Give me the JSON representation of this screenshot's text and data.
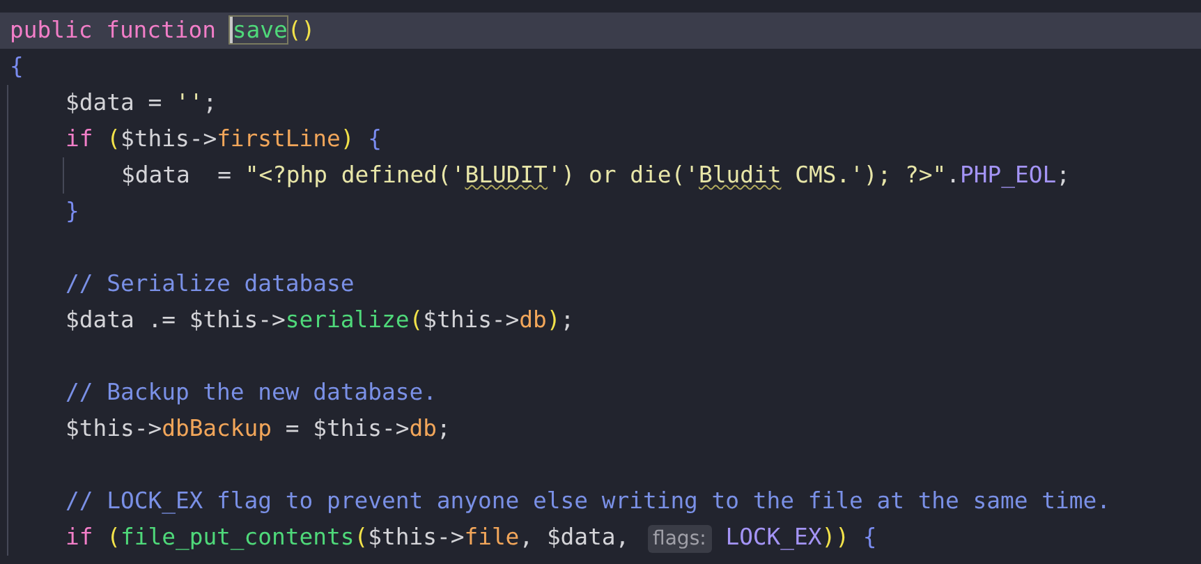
{
  "editor": {
    "lines": [
      {
        "kind": "code",
        "selected": true,
        "tokens": [
          {
            "kind": "keyword",
            "text": "public function "
          },
          {
            "kind": "func",
            "text": "save",
            "boxed": true
          },
          {
            "kind": "paren",
            "text": "()"
          }
        ]
      },
      {
        "kind": "code",
        "selected": false,
        "tokens": [
          {
            "kind": "brace",
            "text": "{"
          }
        ],
        "children": [
          {
            "kind": "code",
            "selected": false,
            "tokens": [
              {
                "kind": "var",
                "text": "$data"
              },
              {
                "kind": "plain",
                "text": " = "
              },
              {
                "kind": "string",
                "text": "''"
              },
              {
                "kind": "plain",
                "text": ";"
              }
            ]
          },
          {
            "kind": "code",
            "selected": false,
            "tokens": [
              {
                "kind": "keyword",
                "text": "if "
              },
              {
                "kind": "paren",
                "text": "("
              },
              {
                "kind": "var",
                "text": "$this->"
              },
              {
                "kind": "prop",
                "text": "firstLine"
              },
              {
                "kind": "paren",
                "text": ")"
              },
              {
                "kind": "brace",
                "text": " {"
              }
            ],
            "children": [
              {
                "kind": "code",
                "selected": false,
                "tokens": [
                  {
                    "kind": "var",
                    "text": "$data"
                  },
                  {
                    "kind": "plain",
                    "text": "  = "
                  },
                  {
                    "kind": "string",
                    "text": "\"<?php defined('"
                  },
                  {
                    "kind": "string",
                    "text": "BLUDIT",
                    "squiggle": true
                  },
                  {
                    "kind": "string",
                    "text": "') or die('"
                  },
                  {
                    "kind": "string",
                    "text": "Bludit",
                    "squiggle": true
                  },
                  {
                    "kind": "string",
                    "text": " CMS.'); ?>\""
                  },
                  {
                    "kind": "plain",
                    "text": "."
                  },
                  {
                    "kind": "const",
                    "text": "PHP_EOL"
                  },
                  {
                    "kind": "plain",
                    "text": ";"
                  }
                ]
              }
            ]
          },
          {
            "kind": "code",
            "selected": false,
            "tokens": [
              {
                "kind": "brace",
                "text": "}"
              }
            ]
          },
          {
            "kind": "blank"
          },
          {
            "kind": "code",
            "selected": false,
            "tokens": [
              {
                "kind": "comment",
                "text": "// Serialize database"
              }
            ]
          },
          {
            "kind": "code",
            "selected": false,
            "tokens": [
              {
                "kind": "var",
                "text": "$data"
              },
              {
                "kind": "plain",
                "text": " .= "
              },
              {
                "kind": "var",
                "text": "$this->"
              },
              {
                "kind": "func",
                "text": "serialize"
              },
              {
                "kind": "paren",
                "text": "("
              },
              {
                "kind": "var",
                "text": "$this->"
              },
              {
                "kind": "prop",
                "text": "db"
              },
              {
                "kind": "paren",
                "text": ")"
              },
              {
                "kind": "plain",
                "text": ";"
              }
            ]
          },
          {
            "kind": "blank"
          },
          {
            "kind": "code",
            "selected": false,
            "tokens": [
              {
                "kind": "comment",
                "text": "// Backup the new database."
              }
            ]
          },
          {
            "kind": "code",
            "selected": false,
            "tokens": [
              {
                "kind": "var",
                "text": "$this->"
              },
              {
                "kind": "prop",
                "text": "dbBackup"
              },
              {
                "kind": "plain",
                "text": " = "
              },
              {
                "kind": "var",
                "text": "$this->"
              },
              {
                "kind": "prop",
                "text": "db"
              },
              {
                "kind": "plain",
                "text": ";"
              }
            ]
          },
          {
            "kind": "blank"
          },
          {
            "kind": "code",
            "selected": false,
            "tokens": [
              {
                "kind": "comment",
                "text": "// LOCK_EX flag to prevent anyone else writing to the file at the same time."
              }
            ]
          },
          {
            "kind": "code",
            "selected": false,
            "tokens": [
              {
                "kind": "keyword",
                "text": "if "
              },
              {
                "kind": "paren",
                "text": "("
              },
              {
                "kind": "func",
                "text": "file_put_contents"
              },
              {
                "kind": "paren",
                "text": "("
              },
              {
                "kind": "var",
                "text": "$this->"
              },
              {
                "kind": "prop",
                "text": "file"
              },
              {
                "kind": "plain",
                "text": ", "
              },
              {
                "kind": "var",
                "text": "$data"
              },
              {
                "kind": "plain",
                "text": ", "
              },
              {
                "kind": "hint",
                "text": "flags:"
              },
              {
                "kind": "const",
                "text": " LOCK_EX"
              },
              {
                "kind": "paren",
                "text": "))"
              },
              {
                "kind": "brace",
                "text": " {"
              }
            ]
          }
        ]
      }
    ]
  }
}
